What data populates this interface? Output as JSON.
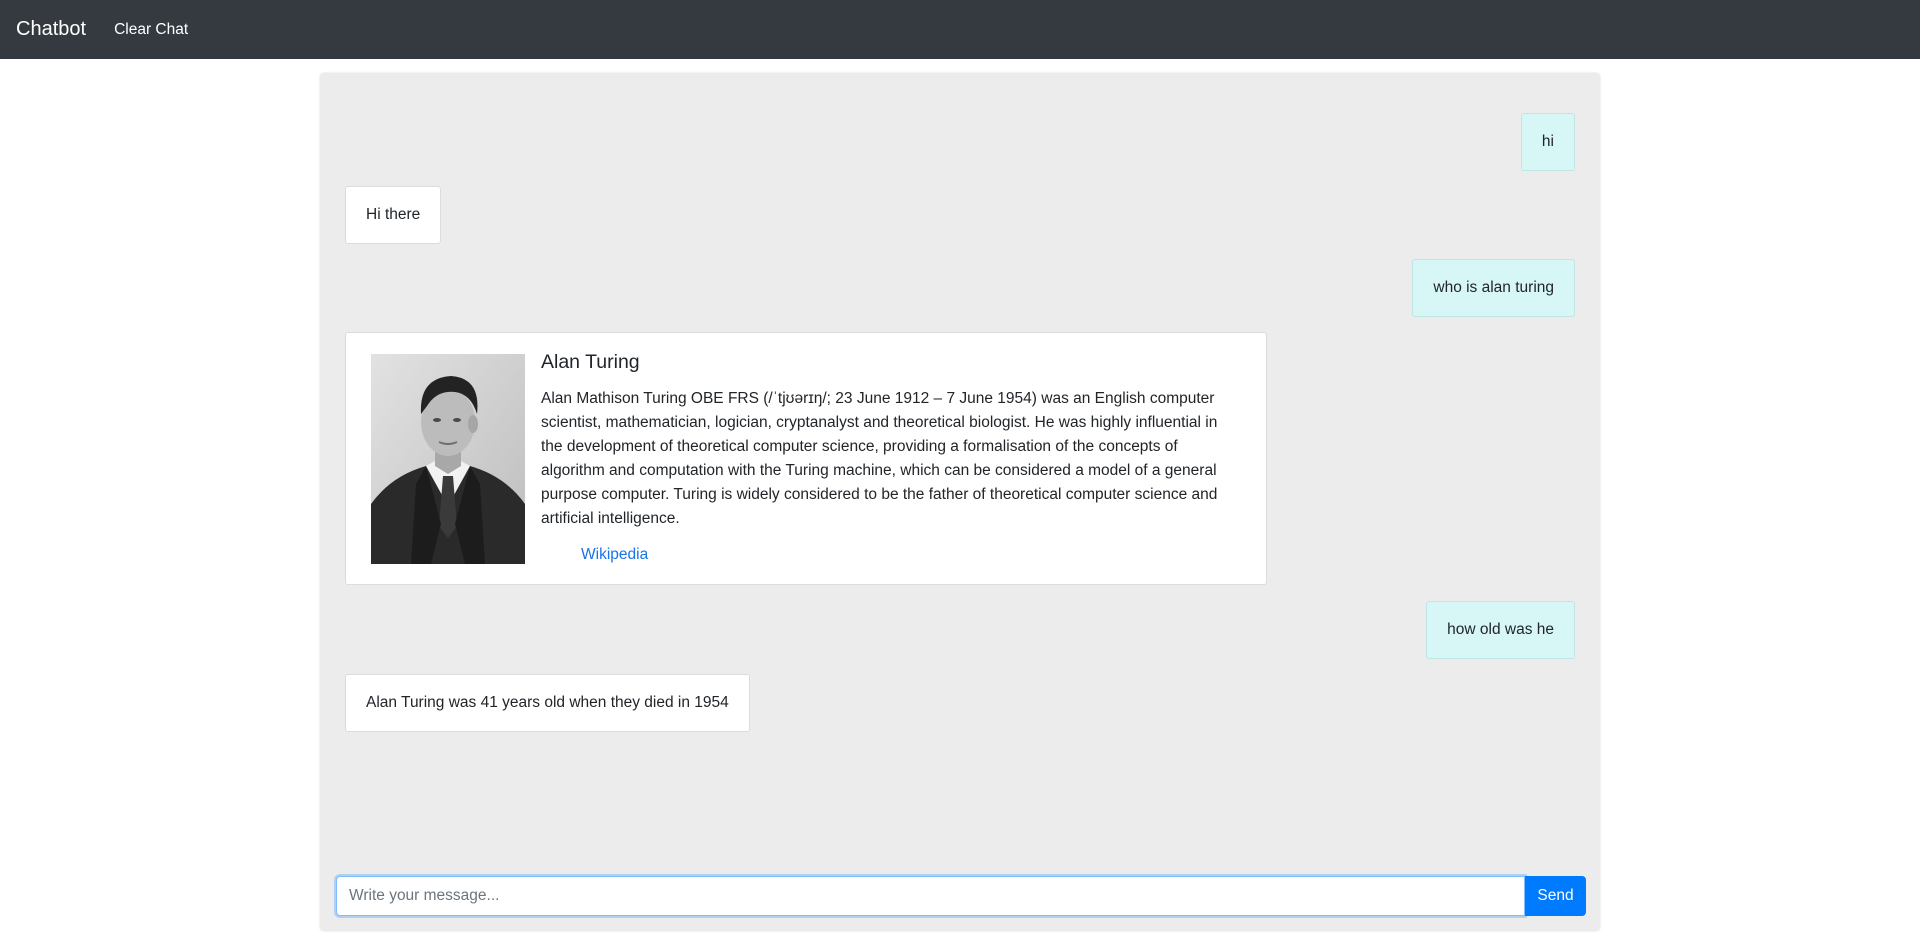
{
  "navbar": {
    "brand": "Chatbot",
    "clear_label": "Clear Chat"
  },
  "messages": [
    {
      "role": "user",
      "text": "hi"
    },
    {
      "role": "bot",
      "text": "Hi there"
    },
    {
      "role": "user",
      "text": "who is alan turing"
    },
    {
      "role": "bot",
      "card": {
        "title": "Alan Turing",
        "text": "Alan Mathison Turing OBE FRS (/ˈtjʊərɪŋ/; 23 June 1912 – 7 June 1954) was an English computer scientist, mathematician, logician, cryptanalyst and theoretical biologist. He was highly influential in the development of theoretical computer science, providing a formalisation of the concepts of algorithm and computation with the Turing machine, which can be considered a model of a general purpose computer. Turing is widely considered to be the father of theoretical computer science and artificial intelligence.",
        "link_label": "Wikipedia"
      }
    },
    {
      "role": "user",
      "text": "how old was he"
    },
    {
      "role": "bot",
      "text": "Alan Turing was 41 years old when they died in 1954"
    }
  ],
  "composer": {
    "placeholder": "Write your message...",
    "value": "",
    "send_label": "Send"
  },
  "colors": {
    "navbar": "#343a40",
    "panel": "#ececec",
    "user_bubble": "#d7f7f7",
    "bot_bubble": "#ffffff",
    "accent": "#007bff"
  }
}
